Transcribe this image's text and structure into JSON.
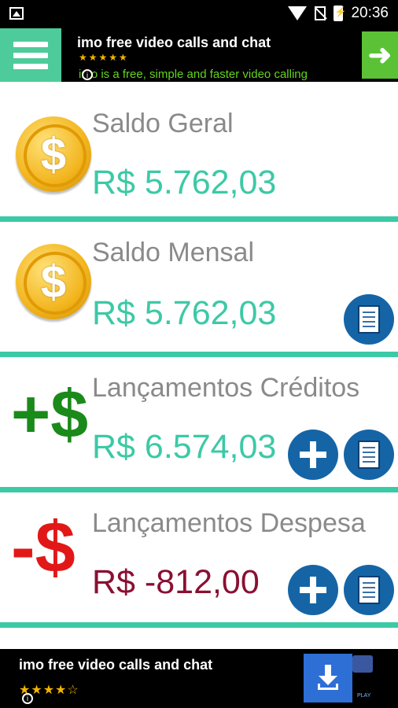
{
  "status_bar": {
    "time": "20:36"
  },
  "top_ad": {
    "title": "imo free video calls and chat",
    "stars": "★★★★★",
    "description": "imo is a free, simple and faster video calling",
    "info": "i",
    "arrow": "➜"
  },
  "cards": [
    {
      "title": "Saldo Geral",
      "amount": "R$ 5.762,03",
      "icon_symbol": "$"
    },
    {
      "title": "Saldo Mensal",
      "amount": "R$ 5.762,03",
      "icon_symbol": "$"
    },
    {
      "title": "Lançamentos Créditos",
      "amount": "R$ 6.574,03",
      "icon_symbol": "+$"
    },
    {
      "title": "Lançamentos Despesa",
      "amount": "R$ -812,00",
      "icon_symbol": "-$"
    }
  ],
  "bottom_ad": {
    "title": "imo free video calls and chat",
    "stars": "★★★★☆",
    "info": "i",
    "store": "PLAY"
  },
  "colors": {
    "accent": "#3cc9a6",
    "menu_bg": "#4ecb9a",
    "button_blue": "#1565a6",
    "negative": "#8a1032"
  }
}
